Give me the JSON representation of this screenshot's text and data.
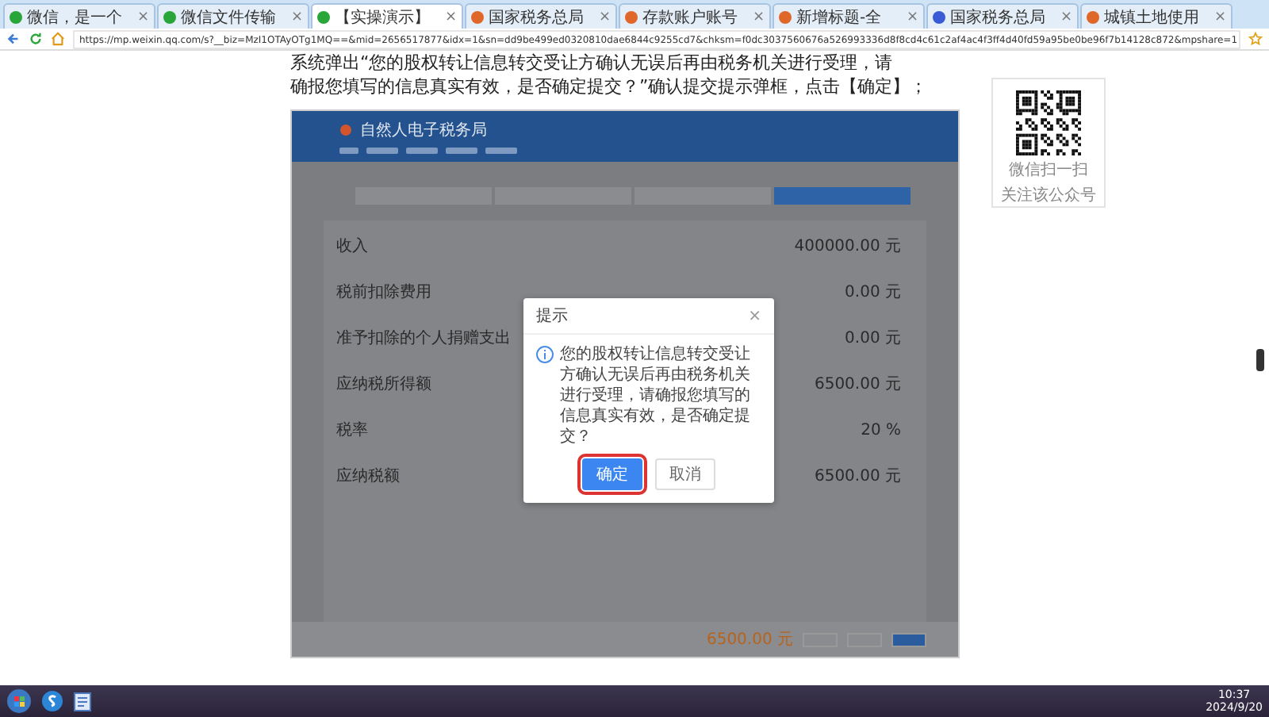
{
  "browser": {
    "tabs": [
      {
        "label": "微信，是一个",
        "close": "×",
        "selected": false
      },
      {
        "label": "微信文件传输",
        "close": "×",
        "selected": false
      },
      {
        "label": "【实操演示】",
        "close": "×",
        "selected": true
      },
      {
        "label": "国家税务总局",
        "close": "×",
        "selected": false
      },
      {
        "label": "存款账户账号",
        "close": "×",
        "selected": false
      },
      {
        "label": "新增标题-全",
        "close": "×",
        "selected": false
      },
      {
        "label": "国家税务总局",
        "close": "×",
        "selected": false
      },
      {
        "label": "城镇土地使用",
        "close": "×",
        "selected": false
      }
    ],
    "url": "https://mp.weixin.qq.com/s?__biz=MzI1OTAyOTg1MQ==&mid=2656517877&idx=1&sn=dd9be499ed0320810dae6844c9255cd7&chksm=f0dc3037560676a526993336d8f8cd4c61c2af4ac4f3ff4d40fd59a95be0be96f7b14128c872&mpshare=1"
  },
  "article": {
    "lines": [
      "系统弹出“您的股权转让信息转交受让方确认无误后再由税务机关进行受理，请",
      "确报您填写的信息真实有效，是否确定提交？”确认提交提示弹框，点击【确定】；"
    ],
    "figure": {
      "site_title": "自然人电子税务局",
      "steps": [
        {
          "selected": false
        },
        {
          "selected": false
        },
        {
          "selected": false
        },
        {
          "selected": true
        }
      ],
      "rows": [
        {
          "label": "收入",
          "value": "400000.00 元"
        },
        {
          "label": "税前扣除费用",
          "value": "0.00 元"
        },
        {
          "label": "准予扣除的个人捐赠支出",
          "value": "0.00 元"
        },
        {
          "label": "应纳税所得额",
          "value": "6500.00 元"
        },
        {
          "label": "税率",
          "value": "20 %"
        },
        {
          "label": "应纳税额",
          "value": "6500.00 元"
        }
      ],
      "dialog": {
        "title": "提示",
        "close": "×",
        "message": "您的股权转让信息转交受让方确认无误后再由税务机关进行受理，请确报您填写的信息真实有效，是否确定提交？",
        "buttons": [
          {
            "label": "确定",
            "kind": "primary"
          },
          {
            "label": "取消",
            "kind": "default"
          }
        ]
      },
      "footer_total": "6500.00 元"
    }
  },
  "qr": {
    "caption": [
      "微信扫一扫",
      "关注该公众号"
    ]
  },
  "taskbar": {
    "time": "10:37",
    "date": "2024/9/20"
  }
}
